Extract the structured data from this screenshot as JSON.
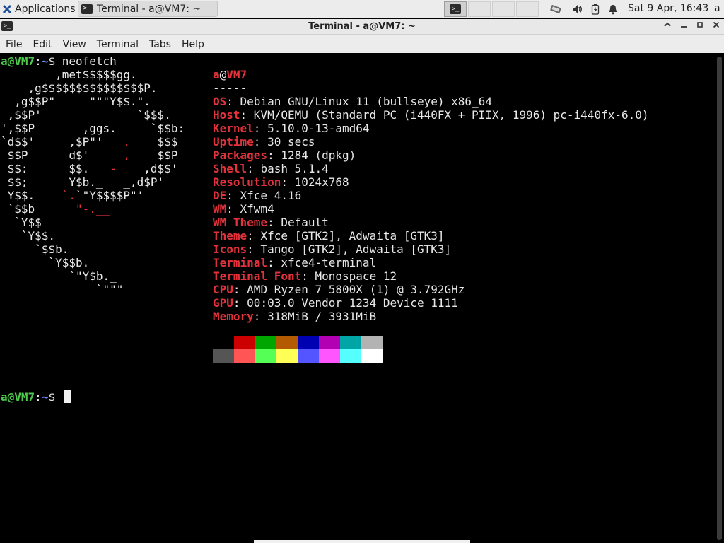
{
  "panel": {
    "apps_label": "Applications",
    "task_label": "Terminal - a@VM7: ~",
    "clock": "Sat  9 Apr, 16:43",
    "user": "a",
    "icons": [
      "xfce-logo-icon",
      "terminal-icon",
      "network-icon",
      "volume-icon",
      "battery-icon",
      "notification-bell-icon"
    ]
  },
  "window": {
    "title": "Terminal - a@VM7: ~",
    "controls": [
      "maximize-up",
      "minimize",
      "maximize",
      "close"
    ]
  },
  "menu": {
    "file": "File",
    "edit": "Edit",
    "view": "View",
    "terminal": "Terminal",
    "tabs": "Tabs",
    "help": "Help"
  },
  "prompt": {
    "user_host": "a@VM7",
    "sep": ":",
    "path": "~",
    "dollar": "$",
    "command": " neofetch"
  },
  "logo": {
    "l1": "       _,met$$$$$gg.",
    "l2": "    ,g$$$$$$$$$$$$$$$P.",
    "l3": "  ,g$$P\"     \"\"\"Y$$.\".",
    "l4": " ,$$P'              `$$$.",
    "l5": "',$$P       ,ggs.     `$$b:",
    "l6a": "`d$$'     ,$P\"'   ",
    "l6b": ".",
    "l6c": "    $$$",
    "l7a": " $$P      d$'     ",
    "l7b": ",",
    "l7c": "    $$P",
    "l8a": " $$:      $$.   ",
    "l8b": "-",
    "l8c": "    ,d$$'",
    "l9": " $$;      Y$b._   _,d$P'",
    "l10a": " Y$$.    ",
    "l10b": "`.",
    "l10c": "`\"Y$$$$P\"'",
    "l11a": " `$$b      ",
    "l11b": "\"-.__",
    "l12": "  `Y$$",
    "l13": "   `Y$$.",
    "l14": "     `$$b.",
    "l15": "       `Y$$b.",
    "l16": "          `\"Y$b._",
    "l17": "              `\"\"\""
  },
  "info": {
    "user": "a",
    "at": "@",
    "host": "VM7",
    "sep": "-----",
    "fields": [
      {
        "label": "OS",
        "value": "Debian GNU/Linux 11 (bullseye) x86_64"
      },
      {
        "label": "Host",
        "value": "KVM/QEMU (Standard PC (i440FX + PIIX, 1996) pc-i440fx-6.0)"
      },
      {
        "label": "Kernel",
        "value": "5.10.0-13-amd64"
      },
      {
        "label": "Uptime",
        "value": "30 secs"
      },
      {
        "label": "Packages",
        "value": "1284 (dpkg)"
      },
      {
        "label": "Shell",
        "value": "bash 5.1.4"
      },
      {
        "label": "Resolution",
        "value": "1024x768"
      },
      {
        "label": "DE",
        "value": "Xfce 4.16"
      },
      {
        "label": "WM",
        "value": "Xfwm4"
      },
      {
        "label": "WM Theme",
        "value": "Default"
      },
      {
        "label": "Theme",
        "value": "Xfce [GTK2], Adwaita [GTK3]"
      },
      {
        "label": "Icons",
        "value": "Tango [GTK2], Adwaita [GTK3]"
      },
      {
        "label": "Terminal",
        "value": "xfce4-terminal"
      },
      {
        "label": "Terminal Font",
        "value": "Monospace 12"
      },
      {
        "label": "CPU",
        "value": "AMD Ryzen 7 5800X (1) @ 3.792GHz"
      },
      {
        "label": "GPU",
        "value": "00:03.0 Vendor 1234 Device 1111"
      },
      {
        "label": "Memory",
        "value": "318MiB / 3931MiB"
      }
    ],
    "palette_top": [
      "#000000",
      "#cc0000",
      "#00a600",
      "#b35b00",
      "#0000b3",
      "#b300b3",
      "#00a6a6",
      "#b3b3b3"
    ],
    "palette_bottom": [
      "#555555",
      "#ff5555",
      "#55ff55",
      "#ffff55",
      "#5555ff",
      "#ff55ff",
      "#55ffff",
      "#ffffff"
    ]
  }
}
